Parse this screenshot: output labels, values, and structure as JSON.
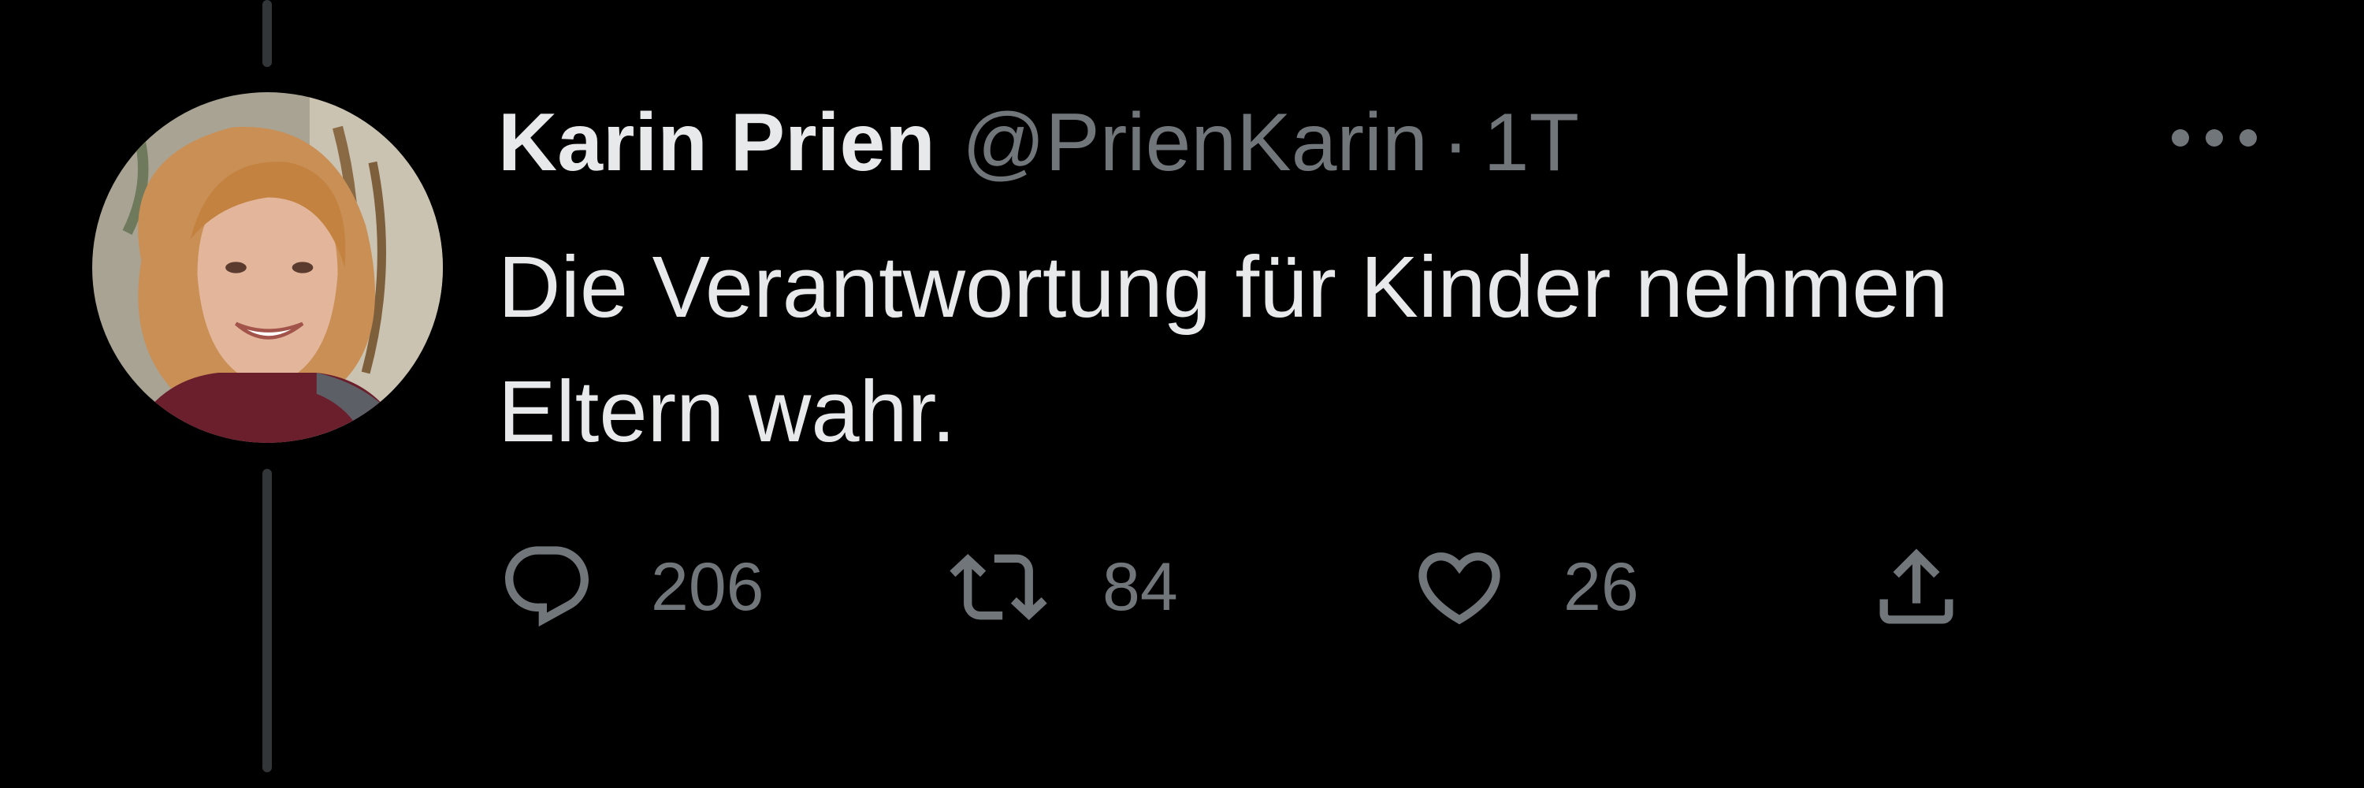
{
  "tweet": {
    "author_name": "Karin Prien",
    "handle": "@PrienKarin",
    "separator": "·",
    "time": "1T",
    "text": "Die Verantwortung für Kinder nehmen\nEltern wahr.",
    "avatar_icon": "avatar-photo"
  },
  "actions": {
    "reply": {
      "icon": "reply-icon",
      "count": "206"
    },
    "retweet": {
      "icon": "retweet-icon",
      "count": "84"
    },
    "like": {
      "icon": "heart-icon",
      "count": "26"
    },
    "share": {
      "icon": "share-icon"
    }
  },
  "menu": {
    "icon": "more-icon"
  },
  "colors": {
    "background": "#000000",
    "primary_text": "#e7e9ea",
    "secondary_text": "#71767b",
    "thread_line": "#333639"
  }
}
